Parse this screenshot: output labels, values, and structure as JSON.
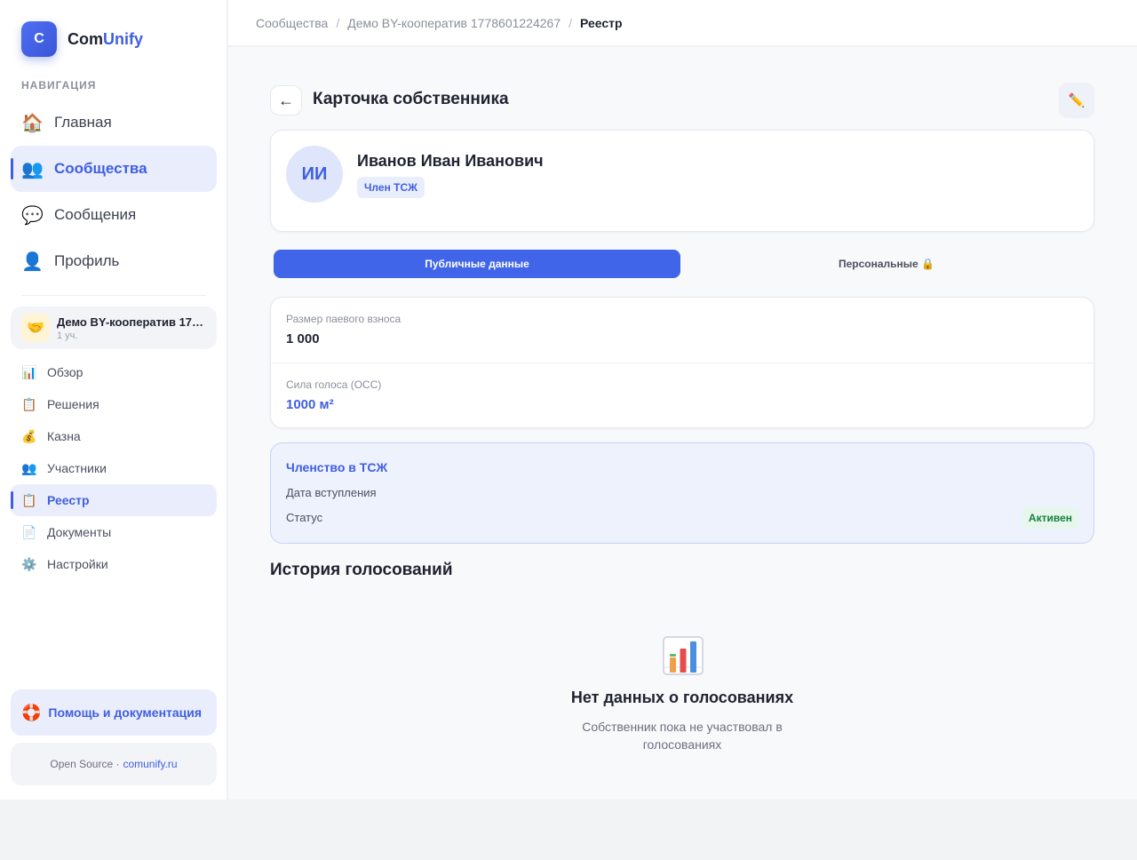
{
  "app": {
    "logo_letter": "C",
    "name_part1": "Com",
    "name_part2": "Unify",
    "brand_color": "#3f5ee2"
  },
  "sidebar": {
    "nav_heading": "НАВИГАЦИЯ",
    "main_items": [
      {
        "icon": "house-icon",
        "glyph": "🏠",
        "label": "Главная"
      },
      {
        "icon": "people-icon",
        "glyph": "👥",
        "label": "Сообщества",
        "active": true
      },
      {
        "icon": "speech-bubble-icon",
        "glyph": "💬",
        "label": "Сообщения"
      },
      {
        "icon": "person-icon",
        "glyph": "👤",
        "label": "Профиль"
      }
    ],
    "community": {
      "icon": "handshake-icon",
      "glyph": "🤝",
      "name": "Демо BY-кооператив 1778601224267",
      "meta": "1 уч."
    },
    "sub_items": [
      {
        "icon": "bar-chart-icon",
        "glyph": "📊",
        "label": "Обзор"
      },
      {
        "icon": "clipboard-icon",
        "glyph": "📋",
        "label": "Решения"
      },
      {
        "icon": "money-bag-icon",
        "glyph": "💰",
        "label": "Казна"
      },
      {
        "icon": "people-icon",
        "glyph": "👥",
        "label": "Участники"
      },
      {
        "icon": "clipboard-icon",
        "glyph": "📋",
        "label": "Реестр",
        "active": true
      },
      {
        "icon": "document-icon",
        "glyph": "📄",
        "label": "Документы"
      },
      {
        "icon": "gear-icon",
        "glyph": "⚙️",
        "label": "Настройки"
      }
    ],
    "help": {
      "icon": "lifebuoy-icon",
      "glyph": "🛟",
      "label": "Помощь и документация"
    },
    "footer": {
      "text": "Open Source ·",
      "link": "comunify.ru"
    }
  },
  "breadcrumb": {
    "items": [
      "Сообщества",
      "Демо BY-кооператив 1778601224267"
    ],
    "current": "Реестр",
    "separator": "/"
  },
  "page": {
    "back_glyph": "←",
    "title": "Карточка собственника",
    "edit_glyph": "✏️"
  },
  "owner": {
    "initials": "ИИ",
    "full_name": "Иванов Иван Иванович",
    "role": "Член ТСЖ"
  },
  "tabs": {
    "public": "Публичные данные",
    "personal": "Персональные 🔒",
    "active": "public"
  },
  "public_data": {
    "share_label": "Размер паевого взноса",
    "share_value": "1 000",
    "vote_label": "Сила голоса (ОСС)",
    "vote_value": "1000 м²"
  },
  "membership": {
    "title": "Членство в ТСЖ",
    "join_label": "Дата вступления",
    "status_label": "Статус",
    "status_value": "Активен",
    "status_color": "#15803d"
  },
  "history": {
    "title": "История голосований",
    "empty_icon": "bar-chart-icon",
    "empty_title": "Нет данных о голосованиях",
    "empty_desc": "Собственник пока не участвовал в голосованиях"
  }
}
